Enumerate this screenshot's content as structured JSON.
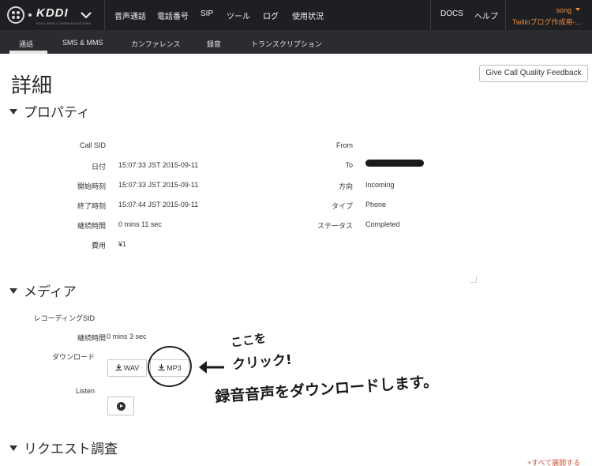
{
  "header": {
    "brand": "KDDI",
    "brand_sub": "KDDI WEB COMMUNICATIONS",
    "nav": [
      "音声通話",
      "電話番号",
      "SIP",
      "ツール",
      "ログ",
      "使用状況"
    ],
    "docs": "DOCS",
    "help": "ヘルプ",
    "user_name": "song",
    "user_sub": "Twilioブログ作成用-..."
  },
  "subnav": {
    "items": [
      "通話",
      "SMS & MMS",
      "カンファレンス",
      "録音",
      "トランスクリプション"
    ]
  },
  "page": {
    "title": "詳細",
    "feedback_button": "Give Call Quality Feedback"
  },
  "properties": {
    "heading": "プロパティ",
    "left": [
      {
        "label": "Call SID",
        "value": ""
      },
      {
        "label": "日付",
        "value": "15:07:33 JST 2015-09-11"
      },
      {
        "label": "開始時刻",
        "value": "15:07:33 JST 2015-09-11"
      },
      {
        "label": "終了時刻",
        "value": "15:07:44 JST 2015-09-11"
      },
      {
        "label": "継続時間",
        "value": "0 mins 11 sec"
      },
      {
        "label": "費用",
        "value": "¥1"
      }
    ],
    "right": [
      {
        "label": "From",
        "value": ""
      },
      {
        "label": "To",
        "value": ""
      },
      {
        "label": "方向",
        "value": "Incoming"
      },
      {
        "label": "タイプ",
        "value": "Phone"
      },
      {
        "label": "ステータス",
        "value": "Completed"
      }
    ]
  },
  "media": {
    "heading": "メディア",
    "recording_sid_label": "レコーディングSID",
    "duration_label": "継続時間",
    "duration_value": "0 mins 3 sec",
    "download_label": "ダウンロード",
    "wav_button": "WAV",
    "mp3_button": "MP3",
    "listen_label": "Listen"
  },
  "request": {
    "heading": "リクエスト調査",
    "expand_all": "+すべて展開する"
  },
  "annotation": {
    "line1": "ここを",
    "line2": "クリック!",
    "line3": "録音音声をダウンロードします。"
  },
  "colors": {
    "topbar": "#1d1f22",
    "subnav": "#2a2c30",
    "accent_orange": "#f08a3c",
    "link_red": "#d0523a"
  }
}
